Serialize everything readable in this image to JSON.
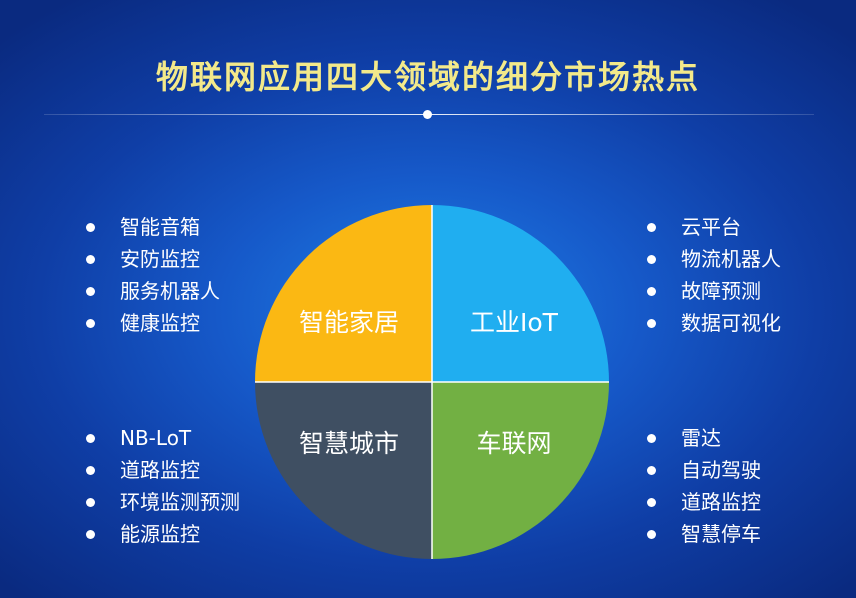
{
  "title": "物联网应用四大领域的细分市场热点",
  "colors": {
    "smart_home": "#fbb813",
    "industrial_iot": "#20aef0",
    "smart_city": "#3f4f62",
    "iov": "#72b043",
    "title": "#f3e98a"
  },
  "pie": {
    "top_left_label": "智能家居",
    "top_right_label": "工业IoT",
    "bottom_left_label": "智慧城市",
    "bottom_right_label": "车联网"
  },
  "lists": {
    "top_left": [
      "智能音箱",
      "安防监控",
      "服务机器人",
      "健康监控"
    ],
    "top_right": [
      "云平台",
      "物流机器人",
      "故障预测",
      "数据可视化"
    ],
    "bottom_left": [
      "NB-LoT",
      "道路监控",
      "环境监测预测",
      "能源监控"
    ],
    "bottom_right": [
      "雷达",
      "自动驾驶",
      "道路监控",
      "智慧停车"
    ]
  }
}
